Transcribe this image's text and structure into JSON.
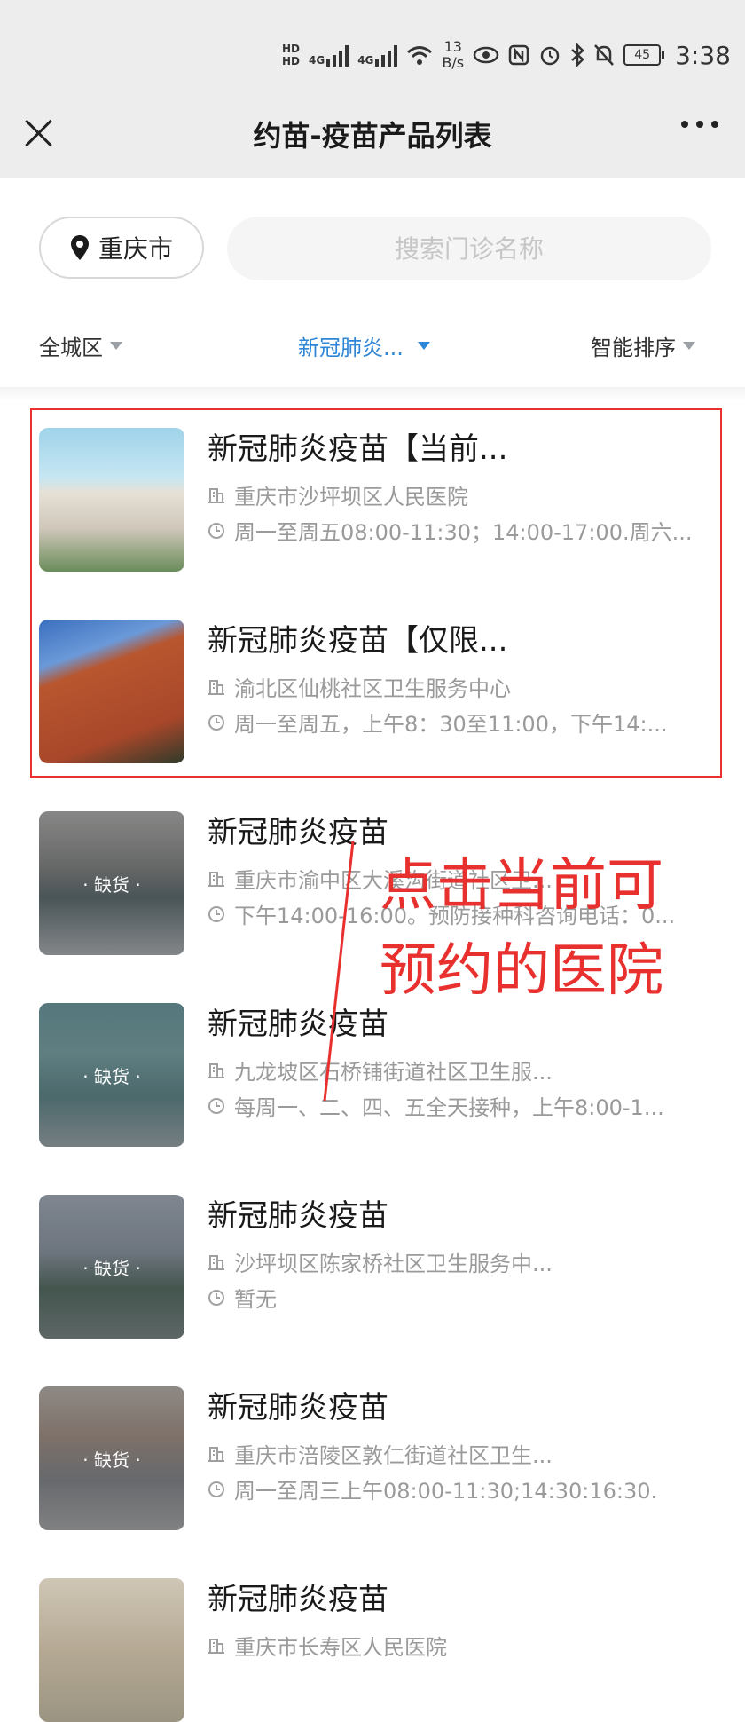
{
  "status_bar": {
    "hd1": "HD",
    "hd2": "HD",
    "net1": "4G",
    "net2": "4G",
    "speed_value": "13",
    "speed_unit": "B/s",
    "battery": "45",
    "time": "3:38"
  },
  "nav": {
    "title": "约苗-疫苗产品列表"
  },
  "location": {
    "city": "重庆市"
  },
  "search": {
    "placeholder": "搜索门诊名称"
  },
  "filters": {
    "district": "全城区",
    "vaccine": "新冠肺炎...",
    "sort": "智能排序"
  },
  "items": [
    {
      "title": "新冠肺炎疫苗【当前...",
      "clinic": "重庆市沙坪坝区人民医院",
      "hours": "周一至周五08:00-11:30；14:00-17:00.周六...",
      "status": ""
    },
    {
      "title": "新冠肺炎疫苗【仅限...",
      "clinic": "渝北区仙桃社区卫生服务中心",
      "hours": "周一至周五，上午8：30至11:00，下午14:...",
      "status": ""
    },
    {
      "title": "新冠肺炎疫苗",
      "clinic": "重庆市渝中区大溪沟街道社区卫...",
      "hours": "下午14:00-16:00。预防接种科咨询电话：0...",
      "status": "· 缺货 ·"
    },
    {
      "title": "新冠肺炎疫苗",
      "clinic": "九龙坡区石桥铺街道社区卫生服...",
      "hours": "每周一、二、四、五全天接种，上午8:00-1...",
      "status": "· 缺货 ·"
    },
    {
      "title": "新冠肺炎疫苗",
      "clinic": "沙坪坝区陈家桥社区卫生服务中...",
      "hours": "暂无",
      "status": "· 缺货 ·"
    },
    {
      "title": "新冠肺炎疫苗",
      "clinic": "重庆市涪陵区敦仁街道社区卫生...",
      "hours": "周一至周三上午08:00-11:30;14:30:16:30.",
      "status": "· 缺货 ·"
    },
    {
      "title": "新冠肺炎疫苗",
      "clinic": "重庆市长寿区人民医院",
      "hours": "",
      "status": ""
    }
  ],
  "annotation": {
    "line1": "点击当前可",
    "line2": "预约的医院",
    "color": "#e8312f"
  },
  "colors": {
    "accent": "#2f86d6",
    "header_bg": "#ededed"
  }
}
